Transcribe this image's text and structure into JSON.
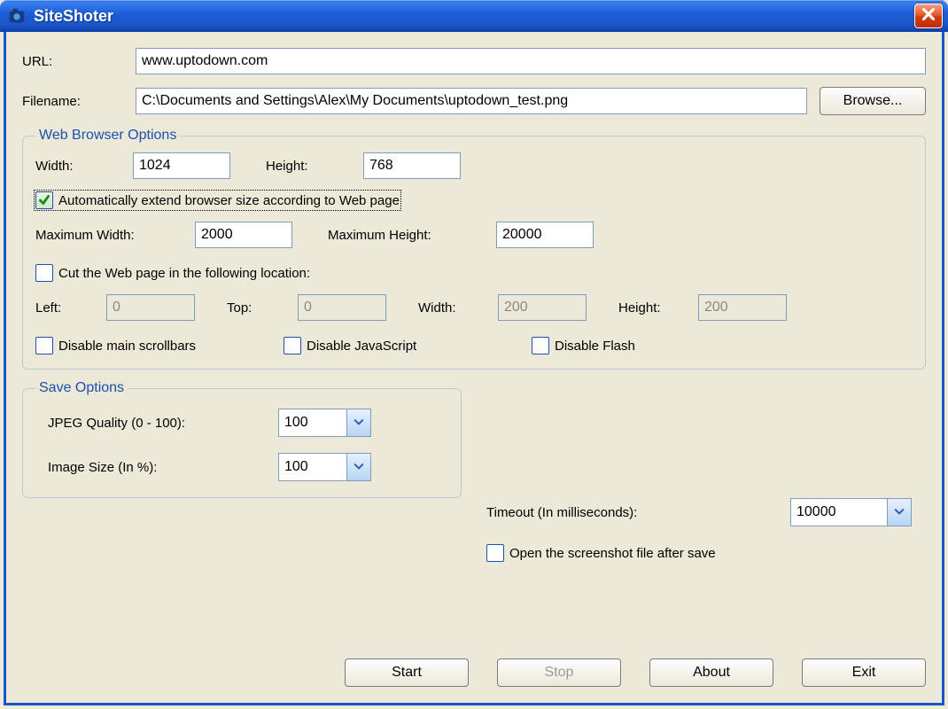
{
  "window": {
    "title": "SiteShoter"
  },
  "url": {
    "label": "URL:",
    "value": "www.uptodown.com"
  },
  "filename": {
    "label": "Filename:",
    "value": "C:\\Documents and Settings\\Alex\\My Documents\\uptodown_test.png",
    "browse": "Browse..."
  },
  "browser_opts": {
    "legend": "Web Browser Options",
    "width_label": "Width:",
    "width_value": "1024",
    "height_label": "Height:",
    "height_value": "768",
    "auto_extend_label": "Automatically extend browser size according to Web page",
    "max_width_label": "Maximum Width:",
    "max_width_value": "2000",
    "max_height_label": "Maximum Height:",
    "max_height_value": "20000",
    "cut_label": "Cut the Web page in the following location:",
    "cut_left_label": "Left:",
    "cut_left_value": "0",
    "cut_top_label": "Top:",
    "cut_top_value": "0",
    "cut_width_label": "Width:",
    "cut_width_value": "200",
    "cut_height_label": "Height:",
    "cut_height_value": "200",
    "disable_scroll_label": "Disable main scrollbars",
    "disable_js_label": "Disable JavaScript",
    "disable_flash_label": "Disable Flash"
  },
  "save_opts": {
    "legend": "Save Options",
    "jpeg_label": "JPEG Quality (0 - 100):",
    "jpeg_value": "100",
    "size_label": "Image Size (In %):",
    "size_value": "100"
  },
  "extra_opts": {
    "timeout_label": "Timeout (In milliseconds):",
    "timeout_value": "10000",
    "open_after_label": "Open the screenshot file after save"
  },
  "buttons": {
    "start": "Start",
    "stop": "Stop",
    "about": "About",
    "exit": "Exit"
  }
}
